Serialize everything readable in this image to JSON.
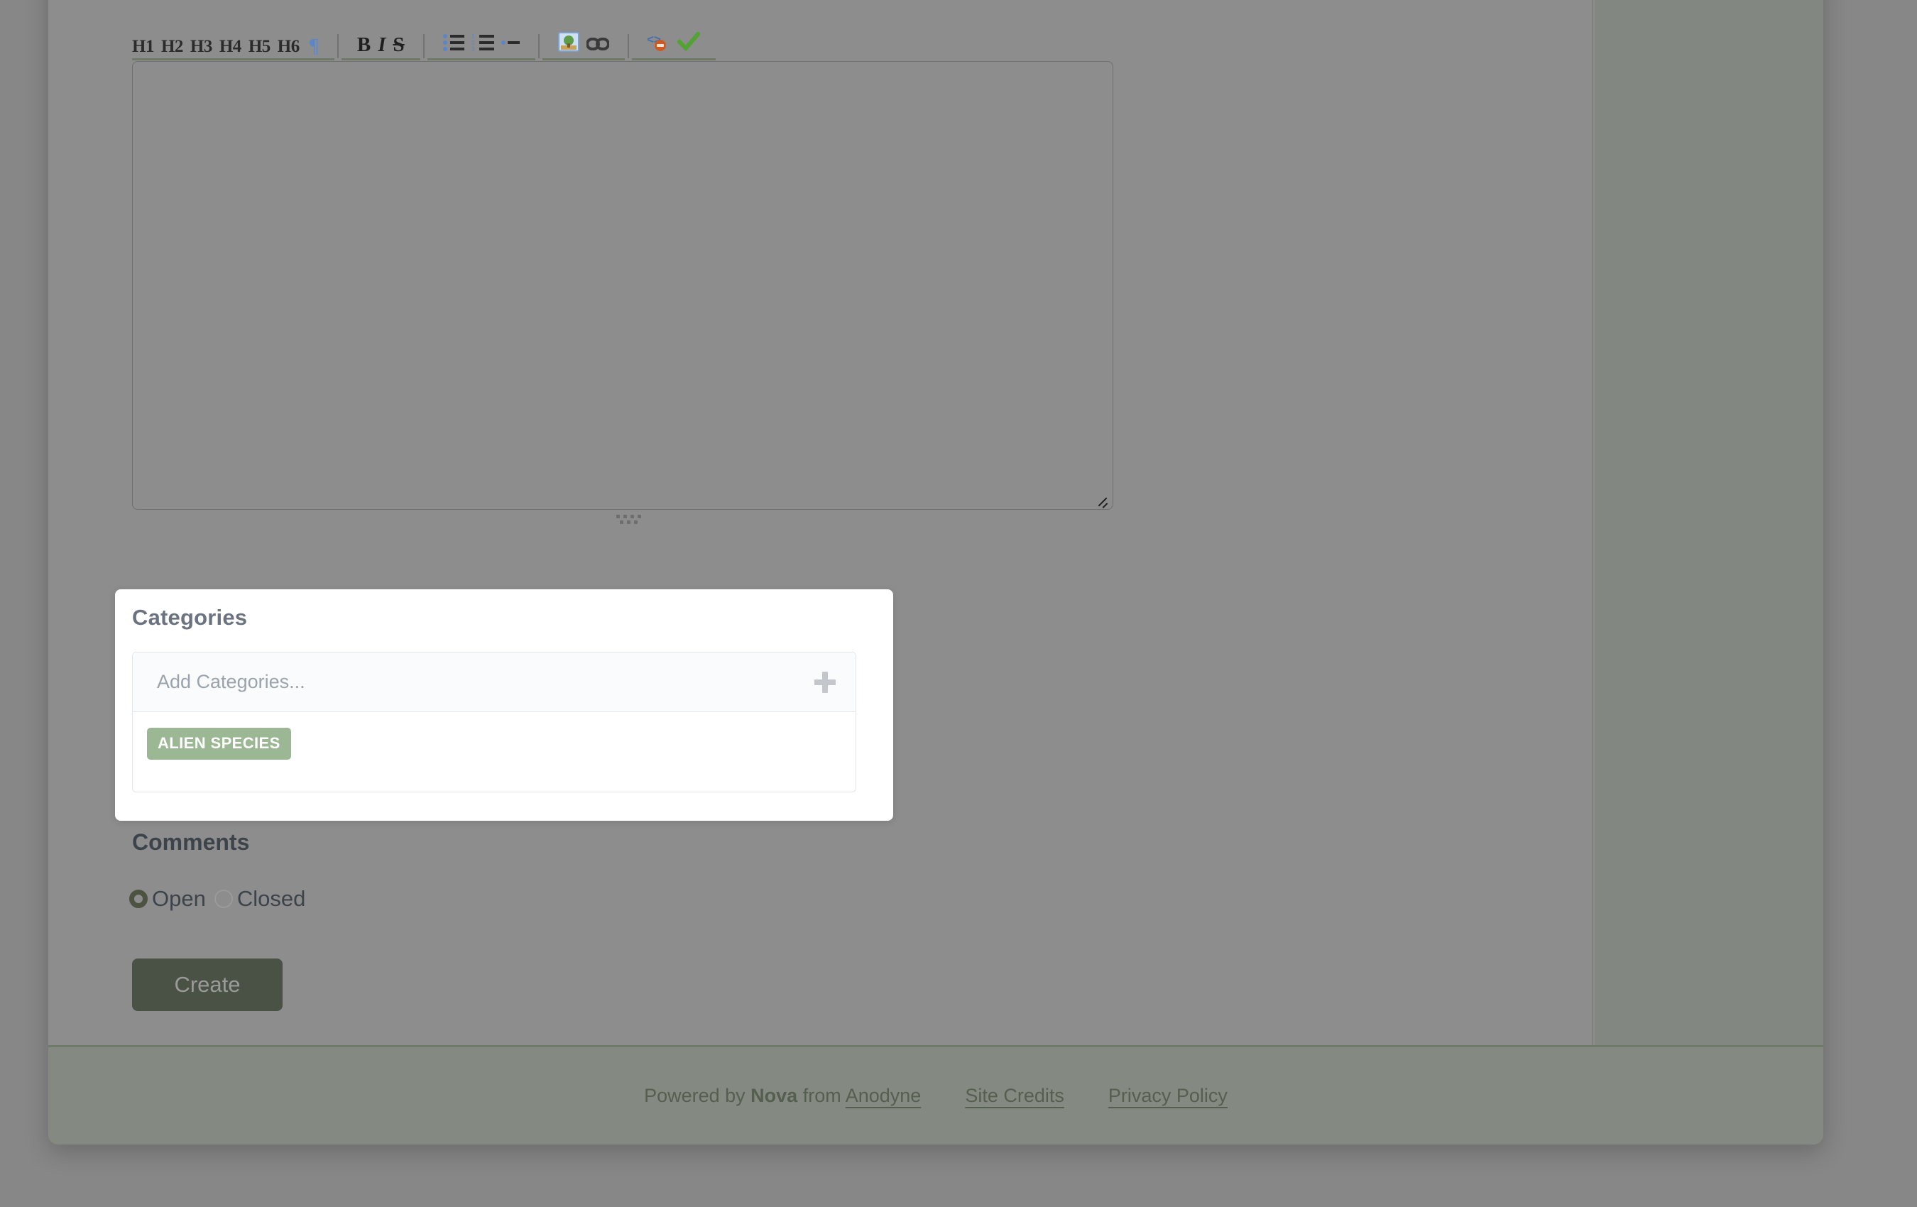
{
  "editor": {
    "heading_buttons": [
      "H1",
      "H2",
      "H3",
      "H4",
      "H5",
      "H6"
    ],
    "pilcrow_glyph": "¶",
    "format_buttons": [
      {
        "label": "B",
        "name": "bold-button"
      },
      {
        "label": "I",
        "name": "italic-button"
      },
      {
        "label": "S",
        "name": "strikethrough-button"
      }
    ],
    "list_icons": [
      "bullet-list-icon",
      "numbered-list-icon",
      "indent-icon"
    ],
    "media_icons": [
      "image-icon",
      "link-icon"
    ],
    "tool_icons": [
      "code-icon",
      "checkmark-icon"
    ],
    "body_value": "",
    "body_placeholder": "",
    "top_field_value": ""
  },
  "categories": {
    "title": "Categories",
    "input_value": "",
    "input_placeholder": "Add Categories...",
    "add_icon": "plus-icon",
    "tags": [
      "ALIEN SPECIES"
    ]
  },
  "comments": {
    "title": "Comments",
    "options": [
      {
        "label": "Open",
        "selected": true
      },
      {
        "label": "Closed",
        "selected": false
      }
    ]
  },
  "actions": {
    "create_label": "Create"
  },
  "footer": {
    "powered_prefix": "Powered by ",
    "brand": "Nova",
    "powered_middle": " from ",
    "vendor": "Anodyne",
    "links": [
      "Site Credits",
      "Privacy Policy"
    ]
  },
  "colors": {
    "overlay": "#8d8d8d",
    "tag_green": "#9cb794",
    "button_green": "#4a5145",
    "radio_green": "#4c5340",
    "footer_border": "#6f7a68",
    "title_gray": "#6b7280"
  }
}
